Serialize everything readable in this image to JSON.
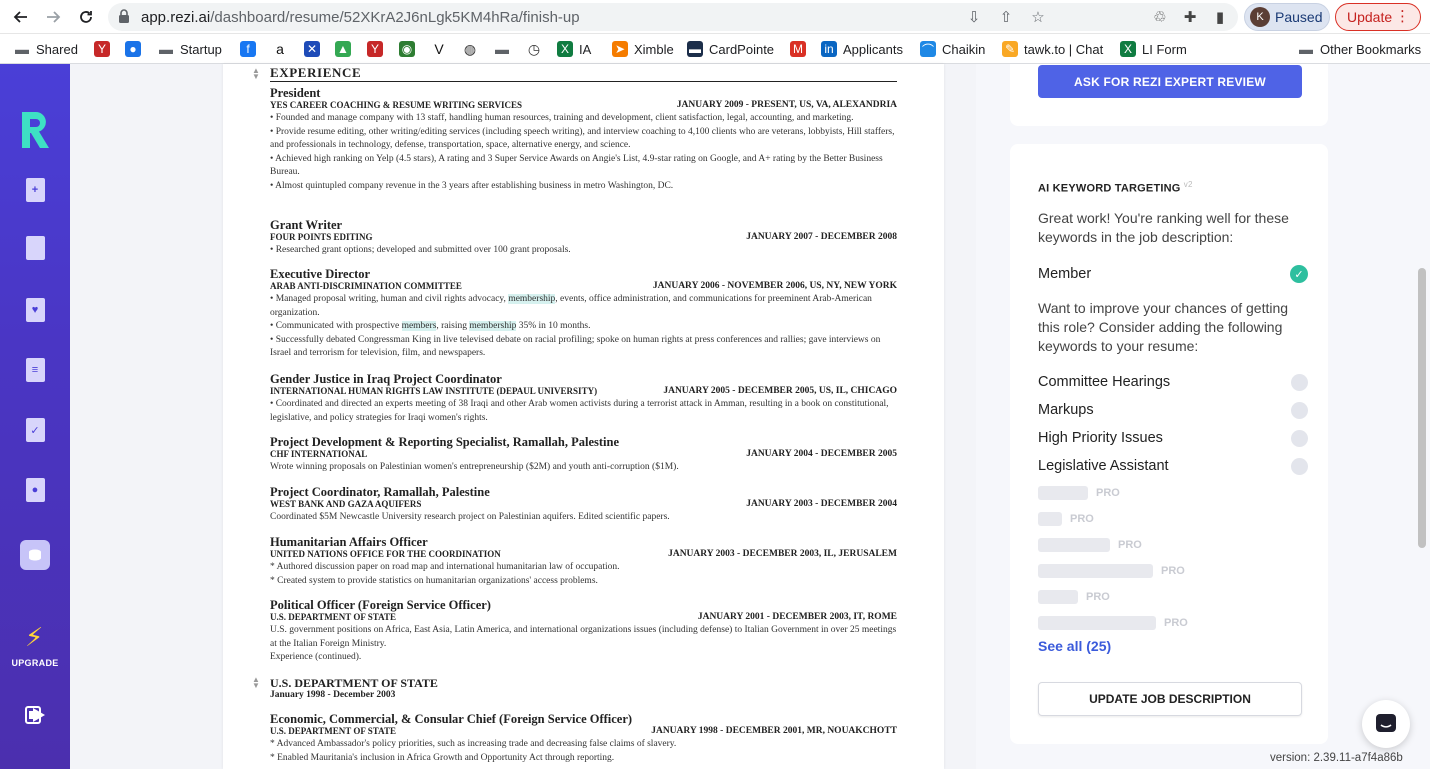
{
  "browser": {
    "url_host": "app.rezi.ai",
    "url_path": "/dashboard/resume/52XKrA2J6nLgk5KM4hRa/finish-up",
    "profile_initial": "K",
    "profile_status": "Paused",
    "update_label": "Update"
  },
  "bookmarks": [
    {
      "label": "Shared",
      "icon": "folder-icon"
    },
    {
      "label": "",
      "icon": "yc-icon"
    },
    {
      "label": "",
      "icon": "globe-blue-icon"
    },
    {
      "label": "Startup",
      "icon": "folder-icon"
    },
    {
      "label": "",
      "icon": "facebook-icon"
    },
    {
      "label": "",
      "icon": "amazon-icon"
    },
    {
      "label": "",
      "icon": "x-cross-icon"
    },
    {
      "label": "",
      "icon": "drive-icon"
    },
    {
      "label": "",
      "icon": "yc-icon"
    },
    {
      "label": "",
      "icon": "green-circle-icon"
    },
    {
      "label": "",
      "icon": "v-icon"
    },
    {
      "label": "",
      "icon": "world-icon"
    },
    {
      "label": "",
      "icon": "folder-icon"
    },
    {
      "label": "",
      "icon": "clock-icon"
    },
    {
      "label": "IA",
      "icon": "excel-icon"
    },
    {
      "label": "Ximble",
      "icon": "arrow-orange-icon"
    },
    {
      "label": "CardPointe",
      "icon": "card-icon"
    },
    {
      "label": "",
      "icon": "gmail-icon"
    },
    {
      "label": "Applicants",
      "icon": "linkedin-icon"
    },
    {
      "label": "Chaikin",
      "icon": "chaikin-icon"
    },
    {
      "label": "tawk.to | Chat",
      "icon": "tawk-icon"
    },
    {
      "label": "LI Form",
      "icon": "excel-icon"
    },
    {
      "label": "Other Bookmarks",
      "icon": "folder-icon"
    }
  ],
  "sidebar": {
    "upgrade_label": "UPGRADE"
  },
  "resume": {
    "section_title": "EXPERIENCE",
    "jobs": [
      {
        "title": "President",
        "org": "YES Career Coaching & Resume Writing Services",
        "date": "January 2009 - Present, US, VA, Alexandria",
        "bullets": [
          "• Founded and manage company with 13 staff, handling human resources, training and development, client satisfaction, legal, accounting, and marketing.",
          "• Provide resume editing, other writing/editing services (including speech writing), and interview coaching to 4,100 clients who are veterans, lobbyists, Hill staffers, and professionals in technology, defense, transportation, space, alternative energy, and science.",
          "• Achieved high ranking on Yelp (4.5 stars), A rating and 3 Super Service Awards on Angie's List, 4.9-star rating on Google, and A+ rating by the Better Business Bureau.",
          "• Almost quintupled company revenue in the 3 years after establishing business in metro Washington, DC."
        ]
      },
      {
        "title": "Grant Writer",
        "org": "FOUR POINTS EDITING",
        "date": "January 2007 - December 2008",
        "bullets": [
          "• Researched grant options; developed and submitted over 100 grant proposals."
        ]
      },
      {
        "title": "Executive Director",
        "org": "ARAB ANTI-DISCRIMINATION COMMITTEE",
        "date": "January 2006 - November 2006, US, NY, New York",
        "b1_pre": "• Managed proposal writing, human and civil rights advocacy, ",
        "b1_hl": "membership",
        "b1_post": ", events, office administration, and communications for preeminent Arab-American organization.",
        "b2_pre": "• Communicated with prospective ",
        "b2_hl1": "members",
        "b2_mid": ", raising ",
        "b2_hl2": "membership",
        "b2_post": " 35% in 10 months.",
        "b3": "• Successfully debated Congressman King in live televised debate on racial profiling; spoke on human rights at press conferences and rallies; gave interviews on Israel and terrorism for television, film, and newspapers."
      },
      {
        "title": "Gender Justice in Iraq Project Coordinator",
        "org": "INTERNATIONAL HUMAN RIGHTS LAW INSTITUTE (DEPAUL UNIVERSITY)",
        "date": "January 2005 - December 2005, US, IL, Chicago",
        "bullets": [
          "• Coordinated and directed an experts meeting of 38 Iraqi and other Arab women activists during a terrorist attack in Amman, resulting in a book on constitutional, legislative, and policy strategies for Iraqi women's rights."
        ]
      },
      {
        "title": "Project Development & Reporting Specialist, Ramallah, Palestine",
        "org": "CHF INTERNATIONAL",
        "date": "January 2004 - December 2005",
        "bullets": [
          "Wrote winning proposals on Palestinian women's entrepreneurship ($2M) and youth anti-corruption ($1M)."
        ]
      },
      {
        "title": "Project Coordinator, Ramallah, Palestine",
        "org": "WEST BANK AND GAZA AQUIFERS",
        "date": "January 2003 - December 2004",
        "bullets": [
          "Coordinated $5M Newcastle University research project on Palestinian aquifers. Edited scientific papers."
        ]
      },
      {
        "title": "Humanitarian Affairs Officer",
        "org": "UNITED NATIONS OFFICE FOR THE COORDINATION",
        "date": "January 2003 - December 2003, IL, Jerusalem",
        "bullets": [
          "* Authored discussion paper on road map and international humanitarian law of occupation.",
          "* Created system to provide statistics on humanitarian organizations' access problems."
        ]
      },
      {
        "title": "Political Officer (Foreign Service Officer)",
        "org": "U.S. DEPARTMENT OF STATE",
        "date": "January 2001 - December 2003, IT, Rome",
        "bullets": [
          "U.S. government positions on Africa, East Asia, Latin America, and international organizations issues (including defense) to Italian Government in over 25 meetings at the Italian Foreign Ministry.",
          "Experience (continued)."
        ]
      },
      {
        "title": "U.S. DEPARTMENT OF STATE",
        "org": "January 1998 - December 2003",
        "date": "",
        "bullets": []
      },
      {
        "title": "Economic, Commercial, & Consular Chief (Foreign Service Officer)",
        "org": "U.S. DEPARTMENT OF STATE",
        "date": "January 1998 - December 2001, MR, Nouakchott",
        "bullets": [
          "* Advanced Ambassador's policy priorities, such as increasing trade and decreasing false claims of slavery.",
          "* Enabled Mauritania's inclusion in Africa Growth and Opportunity Act through reporting."
        ]
      }
    ]
  },
  "panel": {
    "expert_button": "ASK FOR REZI EXPERT REVIEW",
    "kw_heading": "AI KEYWORD TARGETING",
    "kw_heading_sup": "v2",
    "ranking_text": "Great work! You're ranking well for these keywords in the job description:",
    "matched_keyword": "Member",
    "improve_text": "Want to improve your chances of getting this role? Consider adding the following keywords to your resume:",
    "suggested_keywords": [
      "Committee Hearings",
      "Markups",
      "High Priority Issues",
      "Legislative Assistant"
    ],
    "pro_label": "PRO",
    "see_all": "See all (25)",
    "update_jd_button": "UPDATE JOB DESCRIPTION",
    "version": "version: 2.39.11-a7f4a86b"
  },
  "colors": {
    "sidebar": "#4a3fd7",
    "accent_button": "#4f63e6",
    "check": "#2ebf9f",
    "link": "#3b5bdb",
    "keyword_highlight": "#d6f1ef"
  }
}
